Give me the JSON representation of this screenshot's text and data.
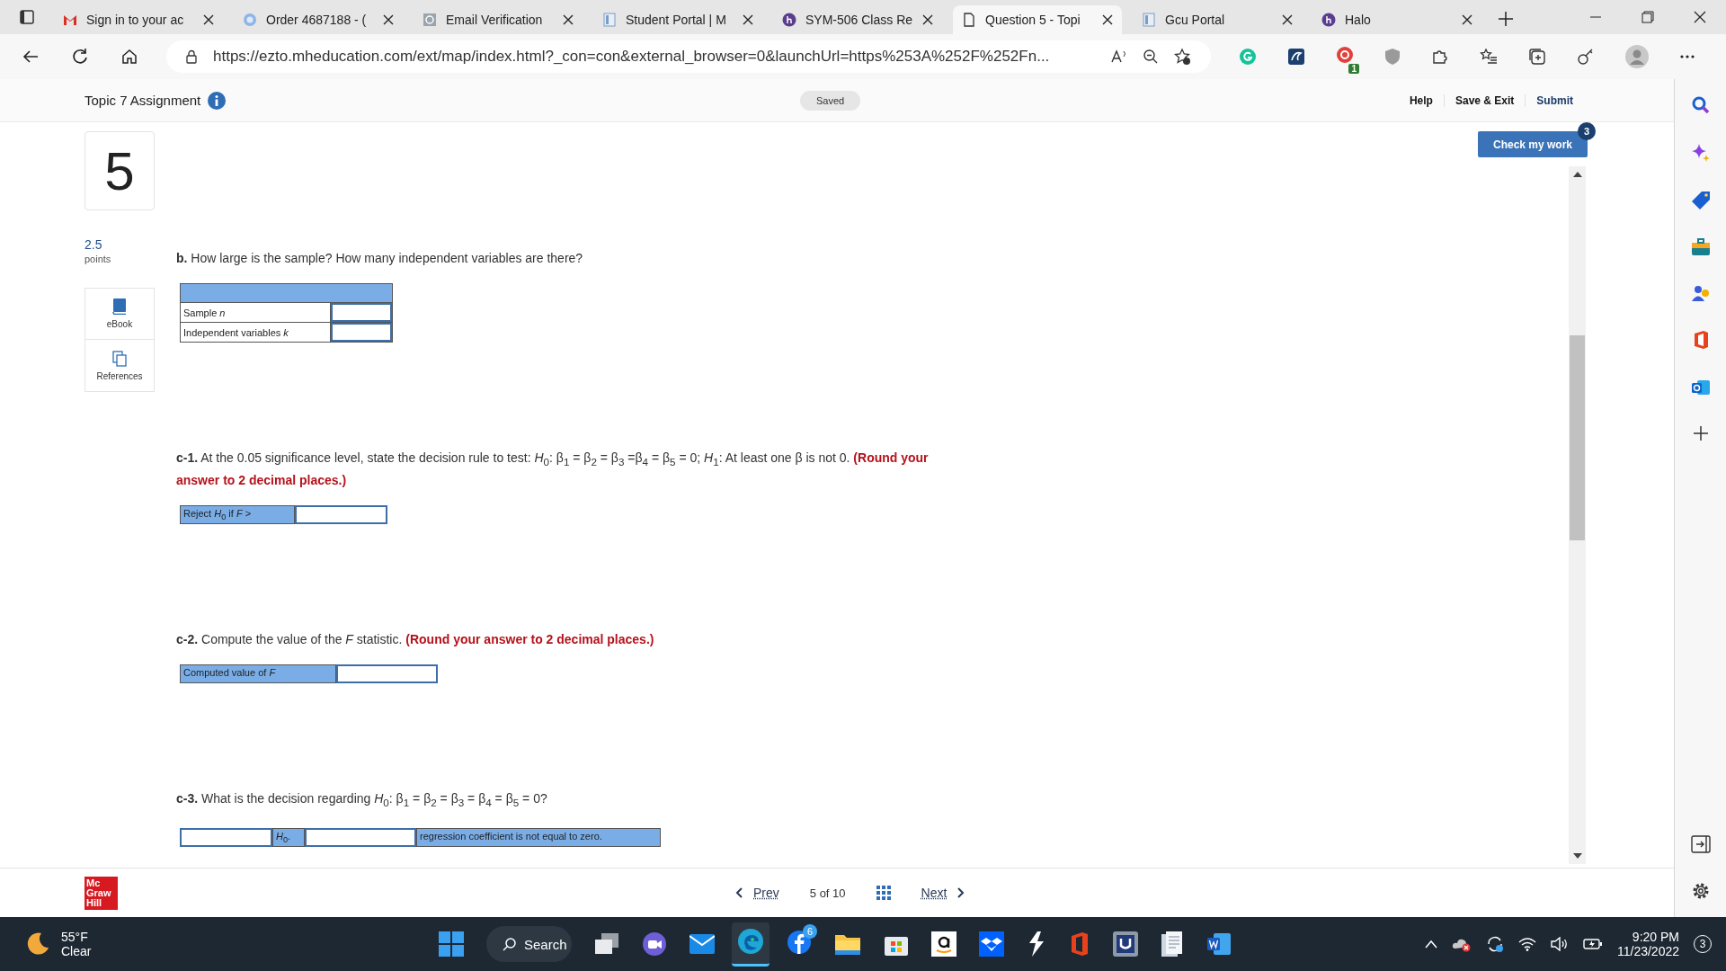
{
  "browser": {
    "tabs": [
      {
        "title": "Sign in to your ac",
        "selected": false
      },
      {
        "title": "Order 4687188 - (",
        "selected": false
      },
      {
        "title": "Email Verification",
        "selected": false
      },
      {
        "title": "Student Portal | M",
        "selected": false
      },
      {
        "title": "SYM-506 Class Re",
        "selected": false
      },
      {
        "title": "Question 5 - Topi",
        "selected": true
      },
      {
        "title": "Gcu Portal",
        "selected": false
      },
      {
        "title": "Halo",
        "selected": false
      }
    ],
    "address": "https://ezto.mheducation.com/ext/map/index.html?_con=con&external_browser=0&launchUrl=https%253A%252F%252Fn...",
    "extension_badge": "1"
  },
  "header": {
    "title": "Topic 7 Assignment",
    "status": "Saved",
    "links": [
      "Help",
      "Save & Exit",
      "Submit"
    ]
  },
  "check_button": {
    "label": "Check my work",
    "badge": "3"
  },
  "question": {
    "number": "5",
    "points": "2.5",
    "points_label": "points"
  },
  "tools": [
    "eBook",
    "References"
  ],
  "parts": [
    {
      "kind": "table",
      "prompt": "**b.** How large is the sample? How many independent variables are there?",
      "rows": [
        {
          "label": "Sample *n*"
        },
        {
          "label": "Independent variables *k*"
        }
      ]
    },
    {
      "kind": "rule",
      "prompt": "**c-1.** At the 0.05 significance level, state the decision rule to test: *H*$_{0}$: β$_{1}$ = β$_{2}$ = β$_{3}$ =β$_{4}$ = β$_{5}$ = 0; *H*$_{1}$: At least one β is not 0.",
      "note": "(Round your answer to 2 decimal places.)",
      "label": "Reject *H*$_{0}$ if *F* >"
    },
    {
      "kind": "rule",
      "prompt": "**c-2.** Compute the value of the *F* statistic.",
      "note": "(Round your answer to 2 decimal places.)",
      "label": "Computed value of *F*"
    },
    {
      "kind": "decision",
      "prompt": "**c-3.** What is the decision regarding *H*$_{0}$: β$_{1}$ = β$_{2}$ = β$_{3}$ = β$_{4}$ = β$_{5}$ = 0?",
      "label": "*H*$_{0}$.",
      "tail": "regression coefficient is not equal to zero."
    }
  ],
  "footer": {
    "logo": [
      "Mc",
      "Graw",
      "Hill"
    ],
    "prev": "Prev",
    "position": "5 of 10",
    "next": "Next"
  },
  "taskbar": {
    "temperature": "55°F",
    "condition": "Clear",
    "search": "Search",
    "app_badge": "6",
    "time": "9:20 PM",
    "date": "11/23/2022",
    "notifications": "3"
  }
}
